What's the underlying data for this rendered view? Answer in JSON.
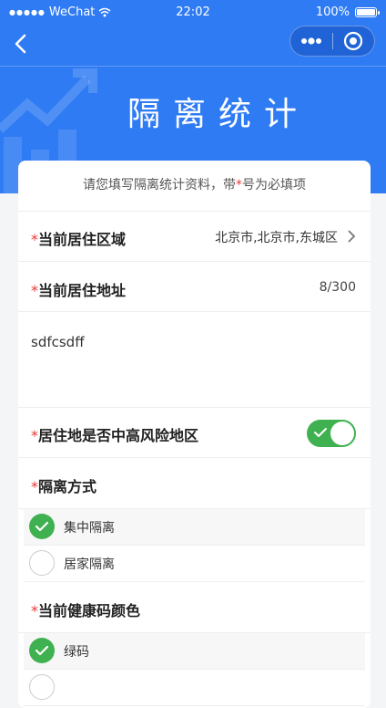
{
  "status_bar": {
    "carrier": "WeChat",
    "time": "22:02",
    "battery": "100%"
  },
  "header": {
    "title": "隔离统计"
  },
  "form": {
    "intro_before": "请您填写隔离统计资料，带",
    "intro_star": "*",
    "intro_after": "号为必填项",
    "required_mark": "*",
    "fields": {
      "area": {
        "label": "当前居住区域",
        "value": "北京市,北京市,东城区"
      },
      "address": {
        "label": "当前居住地址",
        "counter": "8/300",
        "value": "sdfcsdff"
      },
      "risk": {
        "label": "居住地是否中高风险地区",
        "on": true
      },
      "isolation": {
        "label": "隔离方式",
        "options": [
          "集中隔离",
          "居家隔离"
        ],
        "selected": "集中隔离"
      },
      "health_code": {
        "label": "当前健康码颜色",
        "options": [
          "绿码"
        ],
        "selected": "绿码"
      }
    }
  },
  "colors": {
    "primary": "#2f7bf3",
    "success": "#3fb150",
    "required": "#e53935"
  }
}
